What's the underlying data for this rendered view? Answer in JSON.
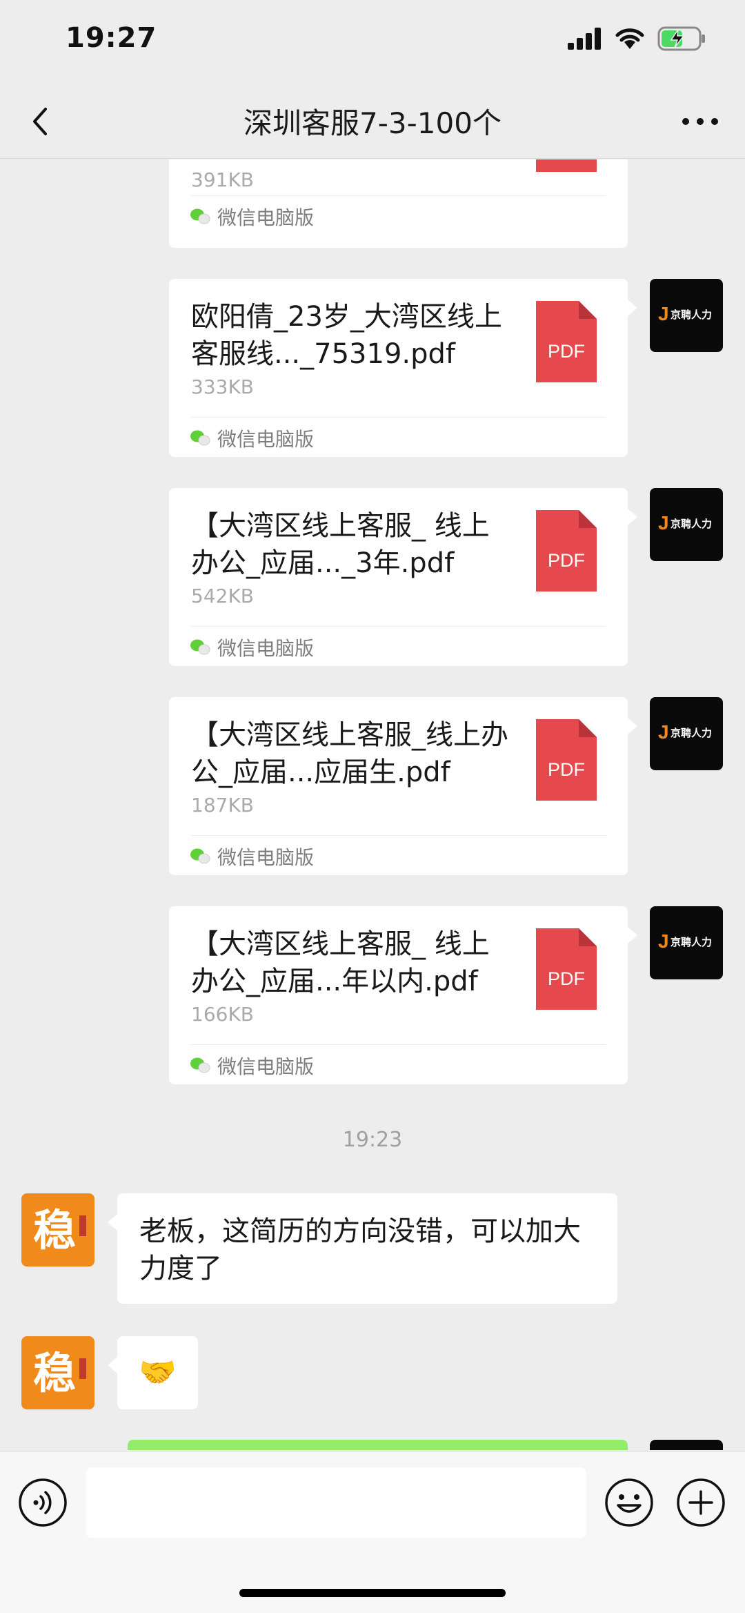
{
  "status_bar": {
    "time": "19:27"
  },
  "header": {
    "title": "深圳客服7-3-100个"
  },
  "files": [
    {
      "name": "",
      "size": "391KB",
      "source": "微信电脑版",
      "icon_label": "PDF"
    },
    {
      "name": "欧阳倩_23岁_大湾区线上客服线..._75319.pdf",
      "size": "333KB",
      "source": "微信电脑版",
      "icon_label": "PDF"
    },
    {
      "name": "【大湾区线上客服_ 线上办公_应届..._3年.pdf",
      "size": "542KB",
      "source": "微信电脑版",
      "icon_label": "PDF"
    },
    {
      "name": "【大湾区线上客服_线上办公_应届...应届生.pdf",
      "size": "187KB",
      "source": "微信电脑版",
      "icon_label": "PDF"
    },
    {
      "name": "【大湾区线上客服_ 线上办公_应届...年以内.pdf",
      "size": "166KB",
      "source": "微信电脑版",
      "icon_label": "PDF"
    }
  ],
  "timestamp": "19:23",
  "messages": [
    {
      "text": "老板，这简历的方向没错，可以加大力度了"
    },
    {
      "text": "🤝"
    }
  ],
  "avatars": {
    "sender_logo_text": "京聘人力",
    "other_logo_text": "稳"
  },
  "colors": {
    "pdf": "#e5484d",
    "green_bubble": "#95ec69",
    "other_avatar": "#f08a1a"
  },
  "icons": [
    "back-icon",
    "more-icon",
    "voice-icon",
    "emoji-icon",
    "plus-icon",
    "pdf-icon",
    "wechat-pc-icon"
  ]
}
